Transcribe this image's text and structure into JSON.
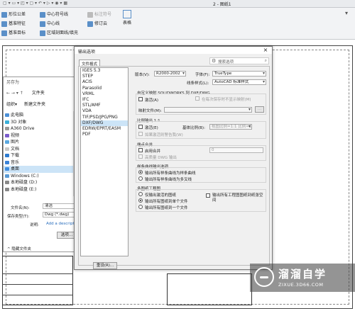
{
  "app": {
    "document_title": "2 - 图纸1",
    "ribbon": {
      "items": [
        "形位公差",
        "基准特征",
        "基准目标",
        "中心符号线",
        "中心线",
        "区域剖面线/填充",
        "标注符号",
        "修订云",
        "表格"
      ]
    }
  },
  "save_dialog": {
    "title": "另存为",
    "path": "文件夹",
    "organize_label": "组织",
    "new_folder_label": "新建文件夹",
    "tree": [
      "此电脑",
      "3D 对象",
      "A360 Drive",
      "视频",
      "图片",
      "文档",
      "下载",
      "音乐",
      "桌面",
      "Windows (C:)",
      "本地磁盘 (D:)",
      "本地磁盘 (E:)"
    ],
    "tree_selected": "桌面",
    "filename_label": "文件名(N):",
    "filename_value": "清洁",
    "type_label": "保存类型(T):",
    "type_value": "Dwg (*.dwg)",
    "description_label": "说明:",
    "description_value": "Add a descripti",
    "options_button": "选项...",
    "hide_folders": "隐藏文件夹"
  },
  "options_dialog": {
    "title": "输出选项",
    "close": "×",
    "tab_label": "文件格式",
    "search_placeholder": "搜索选项",
    "formats": [
      "IGES 5.3",
      "STEP",
      "ACIS",
      "Parasolid",
      "VRML",
      "IFC",
      "STL/AMF",
      "VDA",
      "TIF/PSD/JPG/PNG",
      "DXF/DWG",
      "EDRW/EPRT/EASM",
      "PDF"
    ],
    "format_selected": "DXF/DWG",
    "version_label": "版本(V):",
    "version_value": "R2000-2002",
    "font_label": "字体(F):",
    "font_value": "TrueType",
    "linestyle_label": "线条样式(L):",
    "linestyle_value": "AutoCAD 标准样式",
    "custom_map_title": "自定义映射 SOLIDWORKS 到 DXF/DWG",
    "activate_label": "激活(A)",
    "no_show_label": "在每次保存时不显示映射(M)",
    "map_file_label": "映射文件(M):",
    "map_browse": "...",
    "scale_title": "比例输出 1:1",
    "scale_activate": "激活(E)",
    "base_scale_label": "基体比例(B):",
    "base_scale_value": "视图比例=1:1 比例=1",
    "scale_warn": "如果激活则警告我(W)",
    "endpoints_title": "端点合并",
    "merge_label": "启用合并",
    "merge_value": "0",
    "hq_label": "高质量 DWG 输出",
    "spline_title": "样条曲线输出选项",
    "spline_opt1": "输出所有样条曲线为样条曲线",
    "spline_opt2": "输出所有样条曲线为多叉线",
    "multi_title": "多图纸工程图",
    "multi_opt1": "仅输出激活的图纸",
    "multi_opt2": "输出所有图纸到单个文件",
    "multi_opt3": "输出所有图纸到一个文件",
    "multi_check": "输出所有工程图图纸到纸张空间",
    "reset_button": "重设(R)..."
  },
  "watermark": {
    "title": "溜溜自学",
    "url": "ZIXUE.3D66.COM"
  }
}
